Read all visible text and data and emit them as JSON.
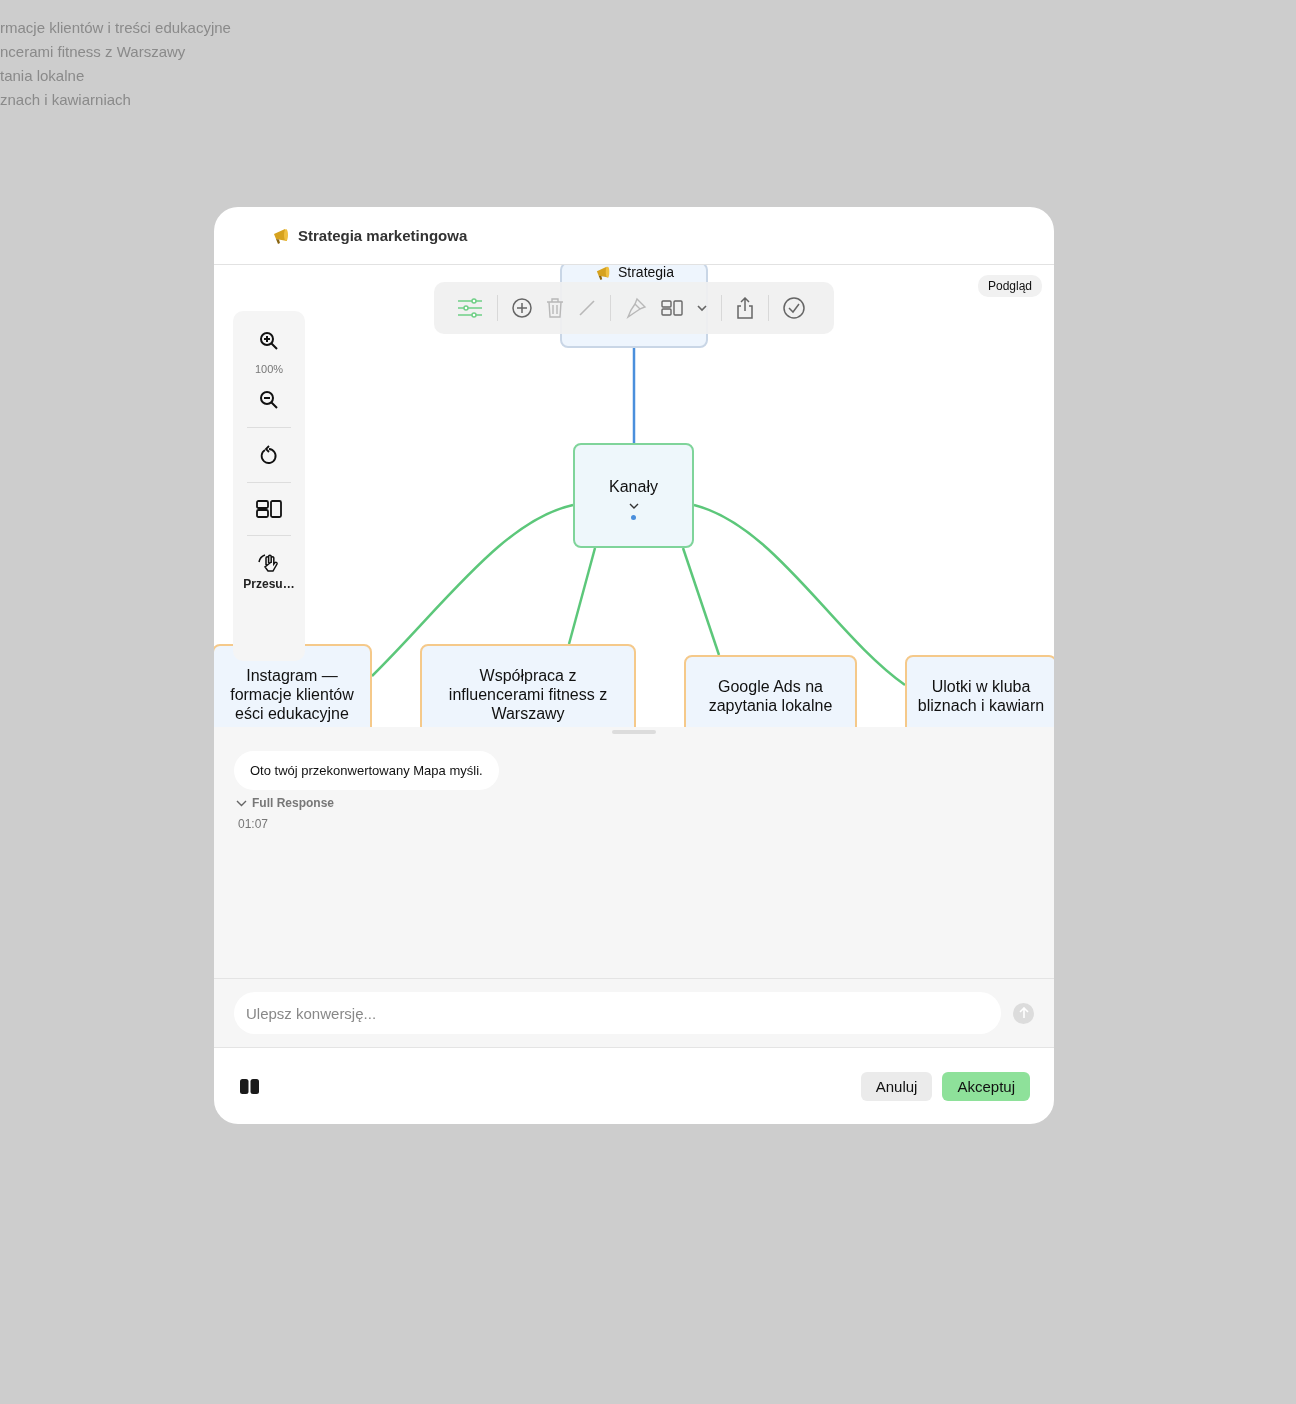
{
  "background_text": [
    "rmacje klientów i treści edukacyjne",
    "ncerami fitness z Warszawy",
    "tania lokalne",
    "znach i kawiarniach"
  ],
  "dialog": {
    "title": "Strategia marketingowa"
  },
  "toolbar": {
    "items": [
      {
        "kind": "settings",
        "selected": true,
        "disabled": false
      },
      {
        "kind": "add",
        "selected": false,
        "disabled": false
      },
      {
        "kind": "delete",
        "selected": false,
        "disabled": true
      },
      {
        "kind": "line",
        "selected": false,
        "disabled": true
      },
      {
        "kind": "style",
        "selected": false,
        "disabled": true
      },
      {
        "kind": "layout",
        "selected": false,
        "disabled": false
      },
      {
        "kind": "dropdown",
        "selected": false,
        "disabled": false
      },
      {
        "kind": "share",
        "selected": false,
        "disabled": false
      },
      {
        "kind": "done",
        "selected": false,
        "disabled": false
      }
    ]
  },
  "preview_badge": "Podgląd",
  "zoom_panel": {
    "level": "100%",
    "pan_label": "Przesu…"
  },
  "mindmap": {
    "root": {
      "kind": "root",
      "lines": [
        "Strategia"
      ],
      "children": [
        {
          "kind": "branch",
          "lines": [
            "Kanały"
          ],
          "expanded": true,
          "children": [
            {
              "kind": "leaf",
              "lines": [
                "Instagram —",
                "formacje klientów",
                "eści edukacyjne"
              ]
            },
            {
              "kind": "leaf",
              "lines": [
                "Współpraca z",
                "influencerami fitness z",
                "Warszawy"
              ]
            },
            {
              "kind": "leaf",
              "lines": [
                "Google Ads na",
                "zapytania lokalne"
              ]
            },
            {
              "kind": "leaf",
              "lines": [
                "Ulotki w kluba",
                "bliznach i kawiarn"
              ]
            }
          ]
        }
      ]
    }
  },
  "chat": {
    "message": "Oto twój przekonwertowany Mapa myśli.",
    "details": {
      "label": "Full Response",
      "expanded": true
    },
    "time": "01:07"
  },
  "input": {
    "placeholder": "Ulepsz konwersję...",
    "send_disabled": true
  },
  "buttons": [
    {
      "kind": "cancel",
      "label": "Anuluj"
    },
    {
      "kind": "accept",
      "label": "Akceptuj"
    }
  ]
}
